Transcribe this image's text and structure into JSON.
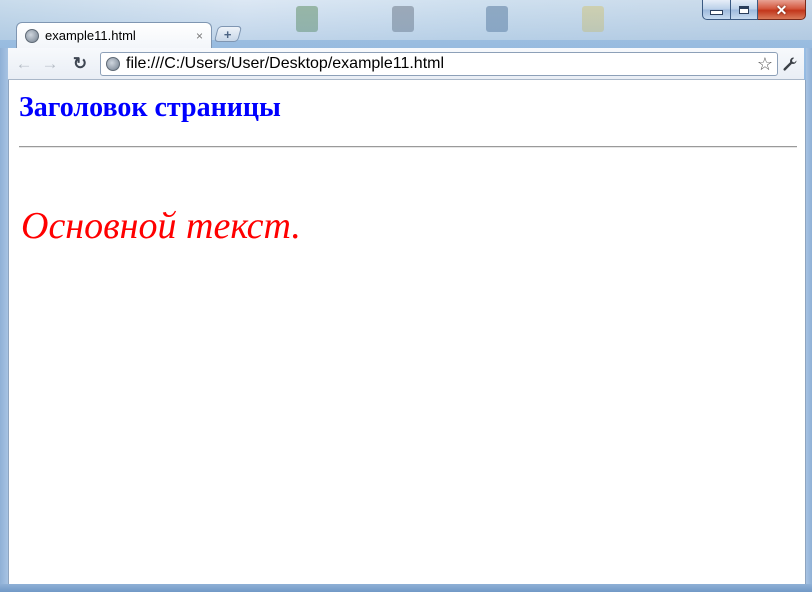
{
  "window": {
    "caption_minimize": "—",
    "caption_maximize": "□",
    "caption_close": "✕"
  },
  "tab": {
    "title": "example11.html",
    "close_glyph": "×",
    "new_tab_glyph": "+"
  },
  "toolbar": {
    "back_glyph": "←",
    "forward_glyph": "→",
    "reload_glyph": "↻",
    "url": "file:///C:/Users/User/Desktop/example11.html",
    "bookmark_glyph": "☆",
    "wrench_glyph": "🔧"
  },
  "page": {
    "heading": "Заголовок страницы",
    "body_text": "Основной текст.",
    "heading_color": "#0000ff",
    "body_text_color": "#ff0000"
  },
  "icons": [
    "globe-icon",
    "close-icon",
    "plus-icon",
    "back-arrow-icon",
    "forward-arrow-icon",
    "reload-icon",
    "star-icon",
    "wrench-icon"
  ]
}
